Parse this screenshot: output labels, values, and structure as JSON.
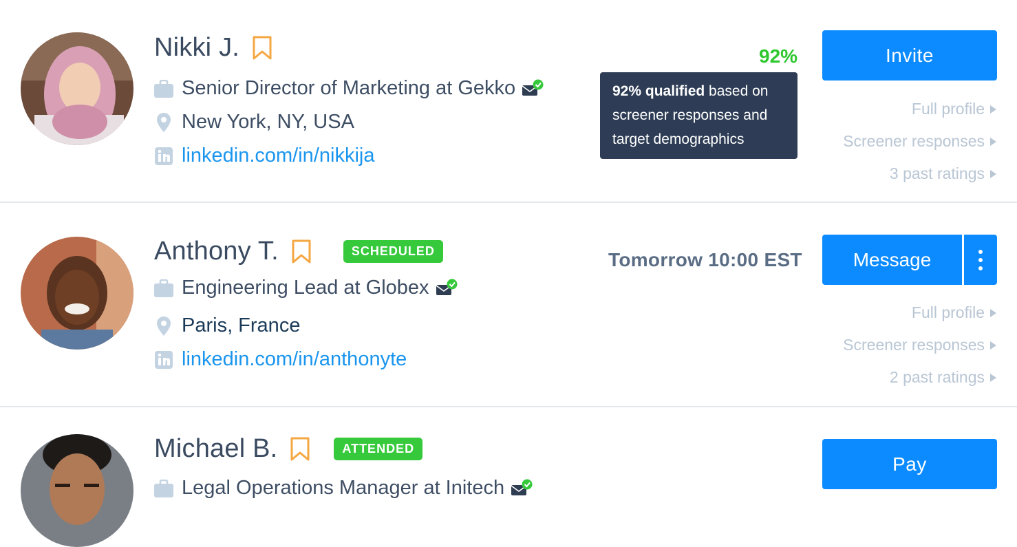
{
  "candidates": [
    {
      "name": "Nikki J.",
      "title": "Senior Director of Marketing at Gekko",
      "location": "New York, NY, USA",
      "linkedin": "linkedin.com/in/nikkija",
      "score": "92%",
      "tooltip": {
        "bold": "92% qualified",
        "rest": " based on screener responses and target demographics"
      },
      "action": "Invite",
      "links": [
        "Full profile",
        "Screener responses",
        "3 past ratings"
      ]
    },
    {
      "name": "Anthony T.",
      "badge": "SCHEDULED",
      "title": "Engineering Lead at Globex",
      "location": "Paris, France",
      "linkedin": "linkedin.com/in/anthonyte",
      "schedule": "Tomorrow 10:00 EST",
      "action": "Message",
      "links": [
        "Full profile",
        "Screener responses",
        "2 past ratings"
      ]
    },
    {
      "name": "Michael B.",
      "badge": "ATTENDED",
      "title": "Legal Operations Manager at Initech",
      "action": "Pay"
    }
  ],
  "colors": {
    "primary": "#0b8bff",
    "badge_green": "#37c93c",
    "score_green": "#2ec72e",
    "bookmark": "#f5a742",
    "link": "#1a95ee",
    "tooltip_bg": "#2e3d55"
  },
  "icons": [
    "bookmark-icon",
    "briefcase-icon",
    "location-pin-icon",
    "linkedin-icon",
    "verified-email-icon",
    "more-vertical-icon",
    "caret-right-icon"
  ]
}
